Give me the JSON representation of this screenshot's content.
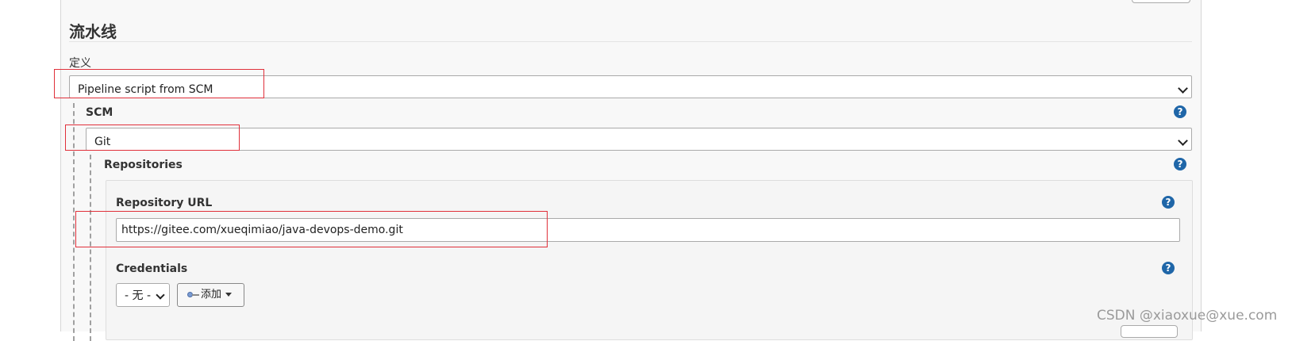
{
  "pipeline": {
    "section_title": "流水线",
    "definition_label": "定义",
    "definition_value": "Pipeline script from SCM"
  },
  "scm": {
    "label": "SCM",
    "value": "Git",
    "help": "?"
  },
  "repositories": {
    "label": "Repositories",
    "help": "?",
    "repository_url": {
      "label": "Repository URL",
      "value": "https://gitee.com/xueqimiao/java-devops-demo.git",
      "help": "?"
    },
    "credentials": {
      "label": "Credentials",
      "selected": "- 无 -",
      "add_label": "添加",
      "help": "?"
    }
  },
  "watermark": "CSDN @xiaoxue@xue.com",
  "colors": {
    "highlight_box": "#e0303a",
    "help_icon": "#1f66a8"
  }
}
